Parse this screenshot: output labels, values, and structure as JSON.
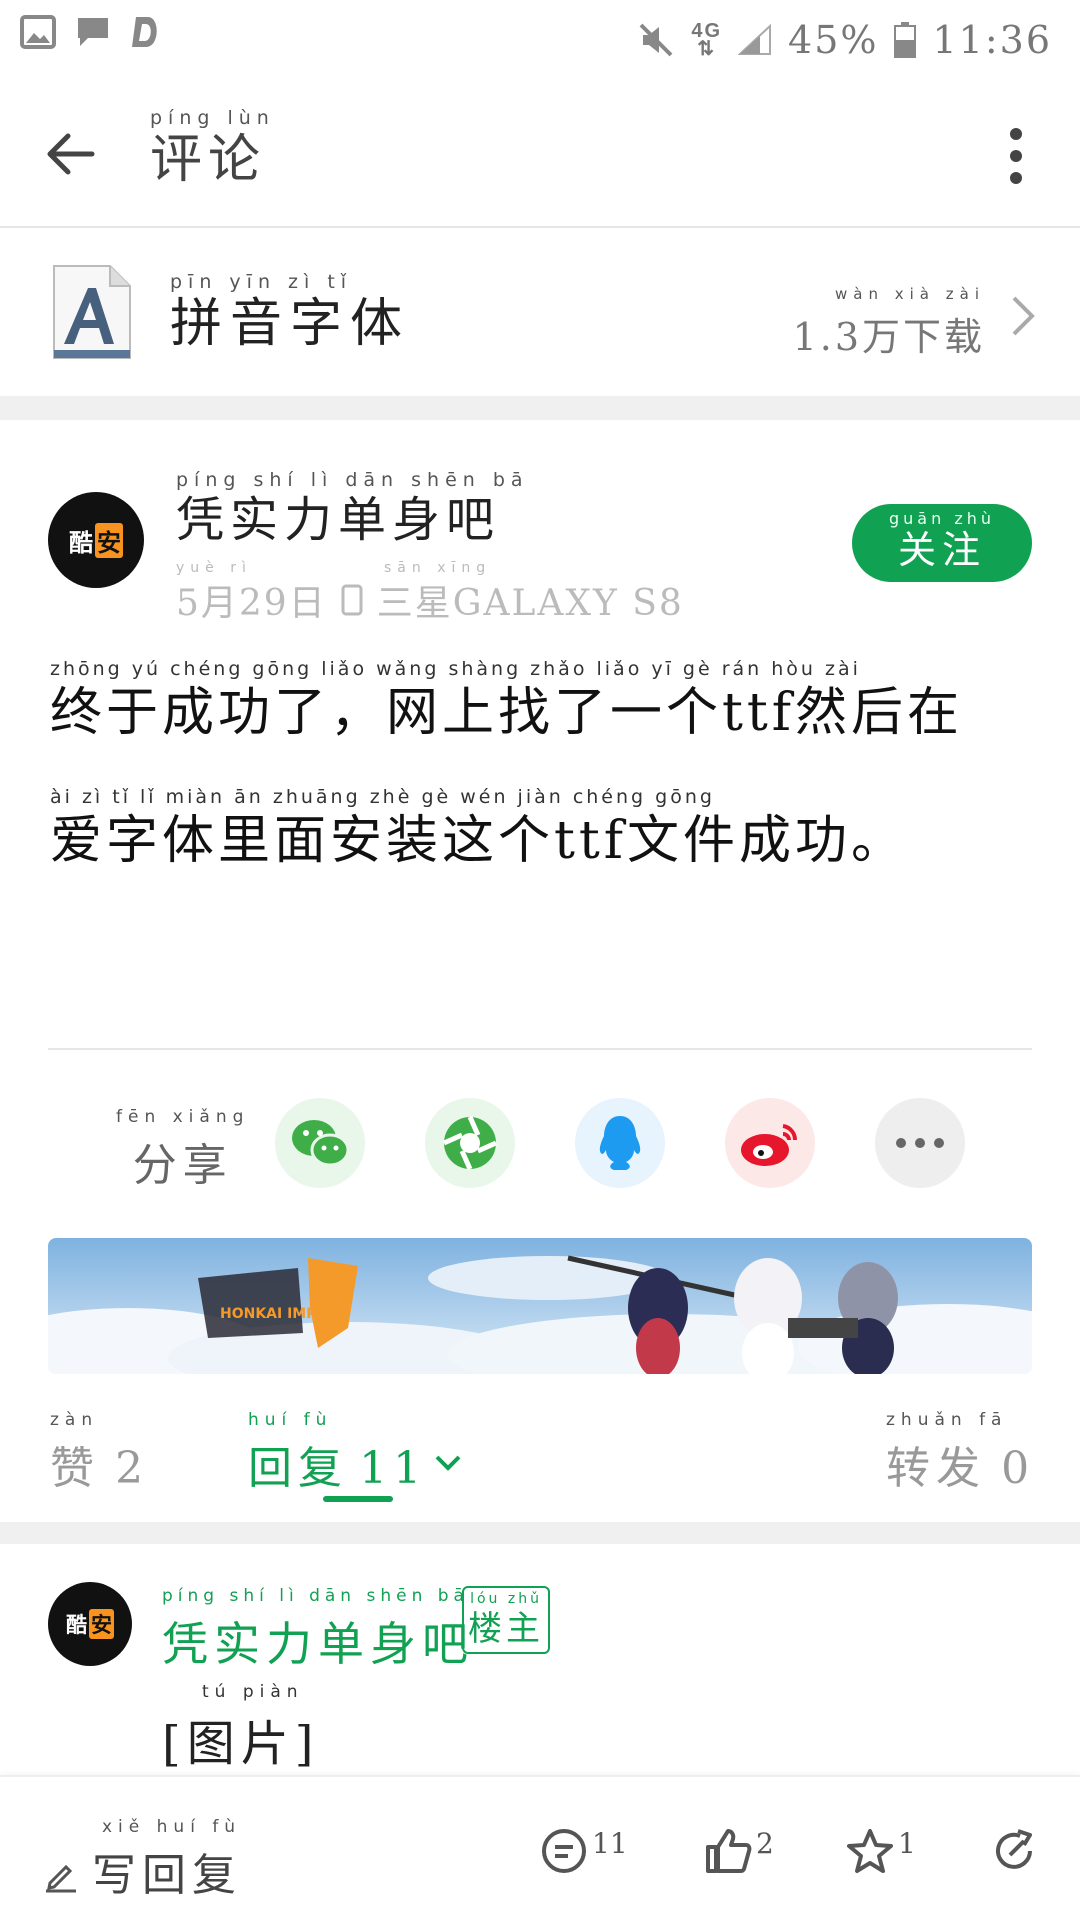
{
  "status_bar": {
    "battery": "45%",
    "time": "11:36",
    "network": "4G"
  },
  "header": {
    "title_pinyin": "píng lùn",
    "title": "评论"
  },
  "app": {
    "name_pinyin": "pīn yīn zì tǐ",
    "name": "拼音字体",
    "downloads_pinyin": "wàn xià zài",
    "downloads": "1.3万下载"
  },
  "post": {
    "author_pinyin": "píng shí lì dān shēn bā",
    "author": "凭实力单身吧",
    "date_pinyin": "yuè rì",
    "date": "5月29日",
    "device_pinyin": "sān xīng",
    "device": "三星GALAXY S8",
    "follow_pinyin": "guān zhù",
    "follow": "关注",
    "line1_pinyin": "zhōng yú chéng gōng liǎo wǎng shàng zhǎo liǎo yī gè rán hòu zài",
    "line1": "终于成功了，网上找了一个ttf然后在",
    "line2_pinyin": "ài zì tǐ lǐ miàn ān zhuāng zhè gè wén jiàn chéng gōng",
    "line2": "爱字体里面安装这个ttf文件成功。"
  },
  "share": {
    "label_pinyin": "fēn xiǎng",
    "label": "分享",
    "targets": [
      "wechat-icon",
      "moments-icon",
      "qq-icon",
      "weibo-icon",
      "more-icon"
    ]
  },
  "actions": {
    "like_pinyin": "zàn",
    "like_label": "赞",
    "like_count": "2",
    "reply_pinyin": "huí fù",
    "reply_label": "回复",
    "reply_count": "11",
    "forward_pinyin": "zhuǎn fā",
    "forward_label": "转发",
    "forward_count": "0"
  },
  "reply": {
    "author_pinyin": "píng shí lì dān shēn bā",
    "author": "凭实力单身吧",
    "badge_pinyin": "lóu zhǔ",
    "badge": "楼主",
    "text_pinyin": "tú piàn",
    "text": "[图片]"
  },
  "avatar": {
    "left": "酷",
    "right": "安"
  },
  "bottom": {
    "write_pinyin": "xiě huí fù",
    "write": "写回复",
    "comments": "11",
    "likes": "2",
    "stars": "1"
  },
  "colors": {
    "accent": "#11a152",
    "muted": "#777777"
  }
}
